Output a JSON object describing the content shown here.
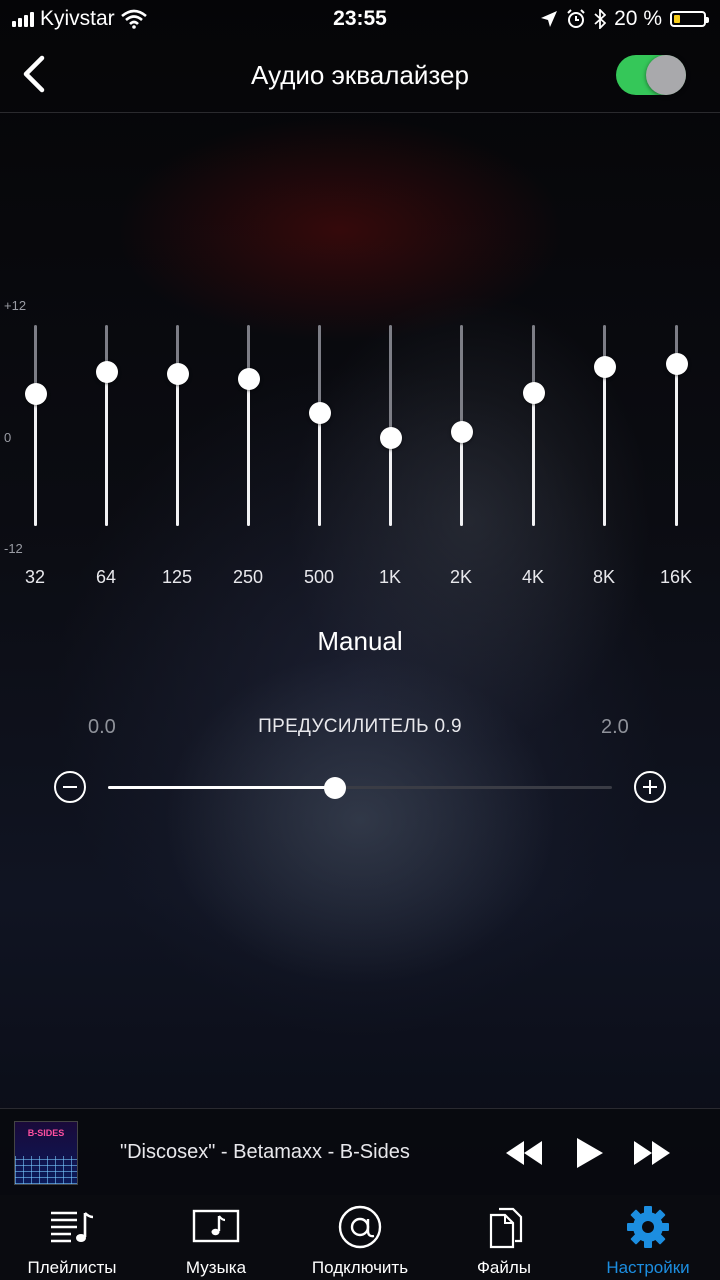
{
  "status": {
    "carrier": "Kyivstar",
    "time": "23:55",
    "battery_text": "20 %",
    "battery_level": 0.2
  },
  "nav": {
    "title": "Аудио эквалайзер",
    "enabled": true
  },
  "eq": {
    "scale_top": "+12",
    "scale_mid": "0",
    "scale_bottom": "-12",
    "bands": [
      {
        "label": "32",
        "gain": 3.8
      },
      {
        "label": "64",
        "gain": 6.4
      },
      {
        "label": "125",
        "gain": 6.2
      },
      {
        "label": "250",
        "gain": 5.6
      },
      {
        "label": "500",
        "gain": 1.5
      },
      {
        "label": "1K",
        "gain": -1.5
      },
      {
        "label": "2K",
        "gain": -0.8
      },
      {
        "label": "4K",
        "gain": 3.9
      },
      {
        "label": "8K",
        "gain": 7.0
      },
      {
        "label": "16K",
        "gain": 7.4
      }
    ],
    "preset": "Manual"
  },
  "preamp": {
    "min": "0.0",
    "max": "2.0",
    "label": "ПРЕДУСИЛИТЕЛЬ 0.9",
    "value": 0.9,
    "range": [
      0,
      2
    ]
  },
  "player": {
    "cover_text": "B-SIDES",
    "title": "\"Discosex\" - Betamaxx - B-Sides"
  },
  "tabs": [
    {
      "label": "Плейлисты",
      "icon": "playlist-icon"
    },
    {
      "label": "Музыка",
      "icon": "music-icon"
    },
    {
      "label": "Подключить",
      "icon": "at-sign-icon"
    },
    {
      "label": "Файлы",
      "icon": "files-icon"
    },
    {
      "label": "Настройки",
      "icon": "gear-icon",
      "active": true
    }
  ],
  "colors": {
    "accent": "#1c8ee0",
    "toggle_on": "#35c759",
    "battery_low": "#f6cc1a"
  }
}
